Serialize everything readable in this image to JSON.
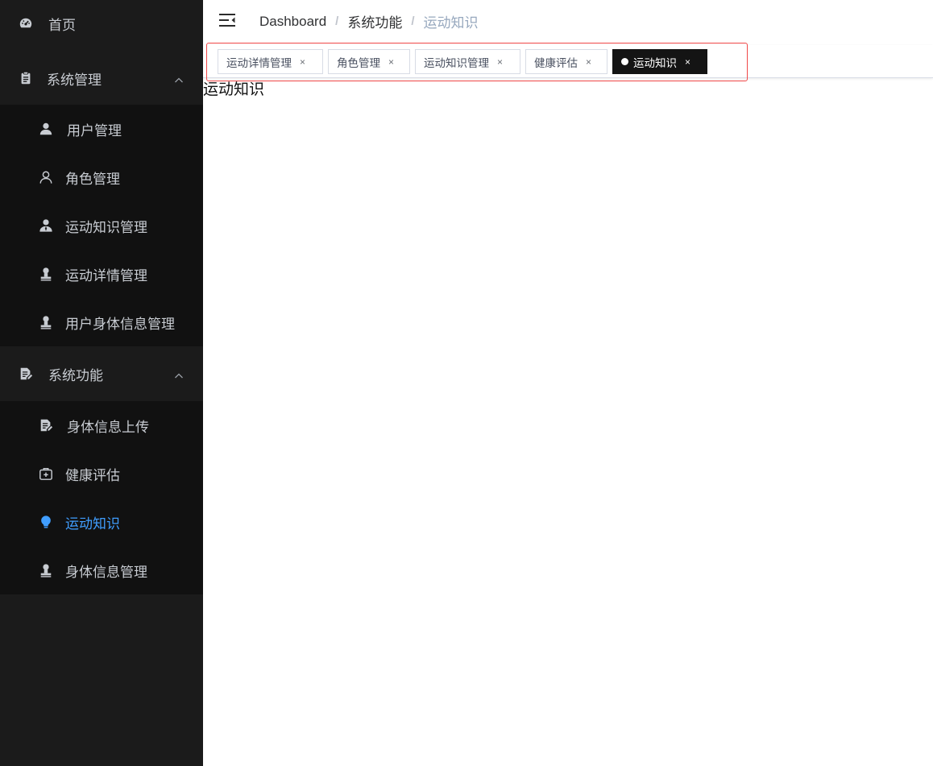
{
  "sidebar": {
    "home": "首页",
    "system_management": {
      "label": "系统管理",
      "items": [
        "用户管理",
        "角色管理",
        "运动知识管理",
        "运动详情管理",
        "用户身体信息管理"
      ]
    },
    "system_functions": {
      "label": "系统功能",
      "items": [
        "身体信息上传",
        "健康评估",
        "运动知识",
        "身体信息管理"
      ]
    },
    "active_color": "#409eff"
  },
  "breadcrumb": [
    "Dashboard",
    "系统功能",
    "运动知识"
  ],
  "tags": [
    {
      "label": "运动详情管理",
      "close": "×"
    },
    {
      "label": "角色管理",
      "close": "×"
    },
    {
      "label": "运动知识管理",
      "close": "×"
    },
    {
      "label": "健康评估",
      "close": "×"
    },
    {
      "label": "运动知识",
      "close": "×",
      "active": true
    }
  ],
  "content": {
    "title": "运动知识"
  },
  "colors": {
    "sidebar_bg": "#1b1b1b",
    "submenu_bg": "#111111",
    "highlight_border": "#f04848"
  }
}
